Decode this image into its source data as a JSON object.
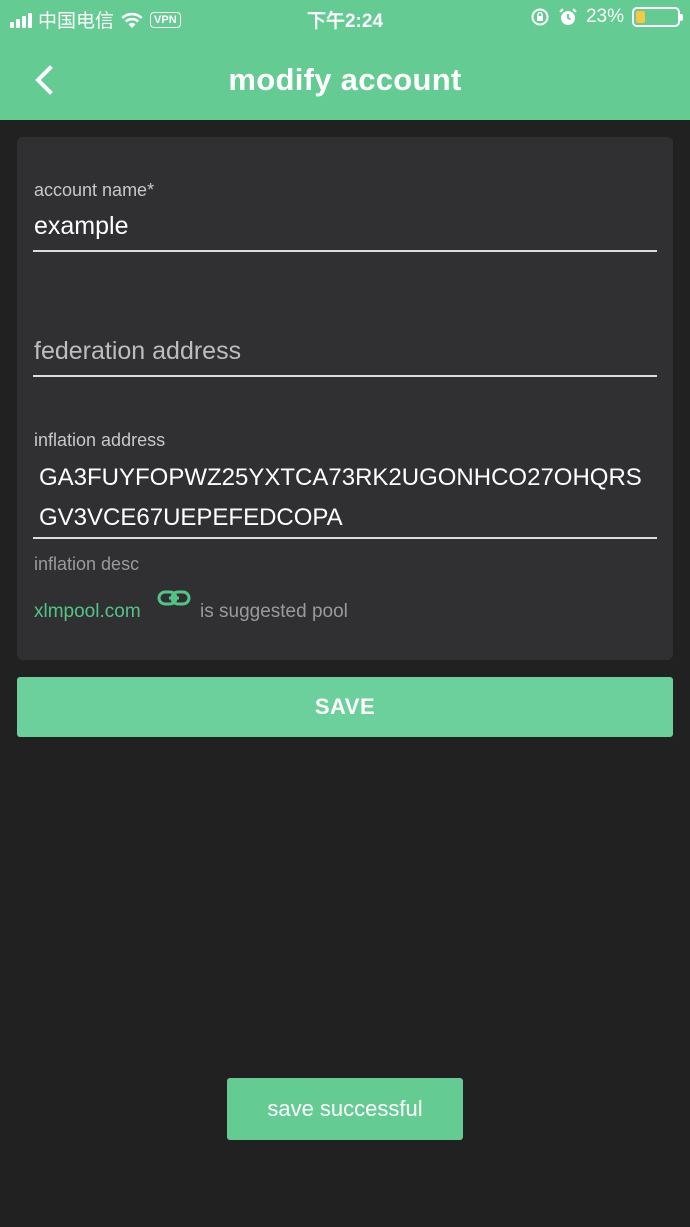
{
  "status_bar": {
    "carrier": "中国电信",
    "vpn": "VPN",
    "time": "下午2:24",
    "battery_percent": "23%",
    "battery_level": 0.23,
    "icons": [
      "signal-icon",
      "wifi-icon",
      "rotation-lock-icon",
      "alarm-icon",
      "battery-icon"
    ]
  },
  "nav": {
    "title": "modify account",
    "back_icon": "chevron-left-icon"
  },
  "form": {
    "account_name_label": "account name*",
    "account_name_value": "example",
    "federation_placeholder": "federation address",
    "inflation_label": "inflation address",
    "inflation_value": "GA3FUYFOPWZ25YXTCA73RK2UGONHCO27OHQRSGV3VCE67UEPEFEDCOPA",
    "inflation_desc_label": "inflation desc",
    "pool_link": "xlmpool.com",
    "pool_link_icon": "link-icon",
    "pool_suffix": "is suggested pool"
  },
  "save_button": {
    "label": "SAVE"
  },
  "toast": {
    "message": "save successful"
  },
  "colors": {
    "accent": "#64cb93",
    "background": "#212121",
    "card": "#303032",
    "link": "#53c388"
  }
}
